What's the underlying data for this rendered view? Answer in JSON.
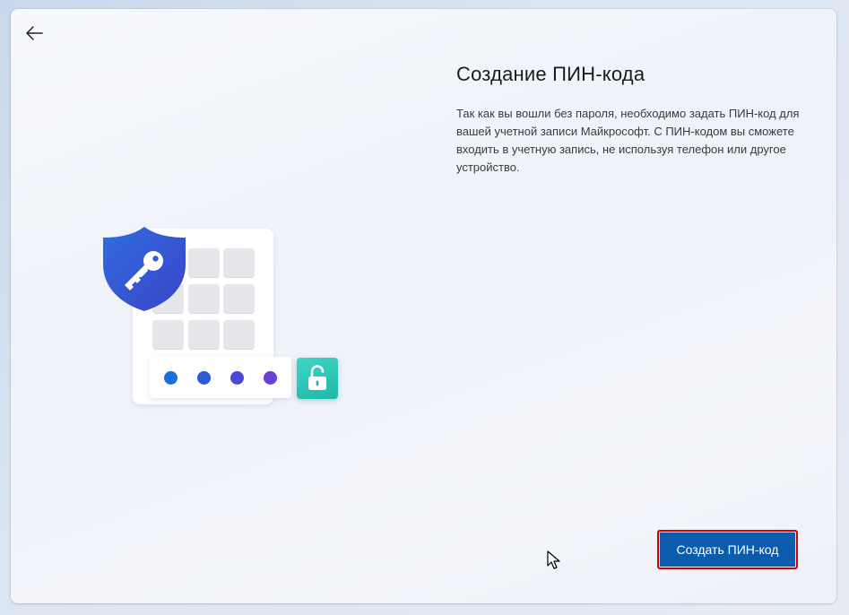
{
  "header": {
    "back_icon": "arrow-left-icon"
  },
  "main": {
    "title": "Создание ПИН-кода",
    "description": "Так как вы вошли без пароля, необходимо задать ПИН-код для вашей учетной записи Майкрософт. С ПИН-кодом вы сможете входить в учетную запись, не используя телефон или другое устройство."
  },
  "illustration": {
    "icons": [
      "shield-key-icon",
      "keypad-icon",
      "unlock-icon"
    ],
    "pin_dot_colors": [
      "#1a6fdc",
      "#2d5bd8",
      "#4a48d6",
      "#6a3fd4"
    ],
    "shield_color": "#2b5fd9",
    "lock_tile_color": "#27c3b2"
  },
  "footer": {
    "primary_button_label": "Создать ПИН-код",
    "primary_button_color": "#0b5cad",
    "highlight_color": "#d40000"
  }
}
